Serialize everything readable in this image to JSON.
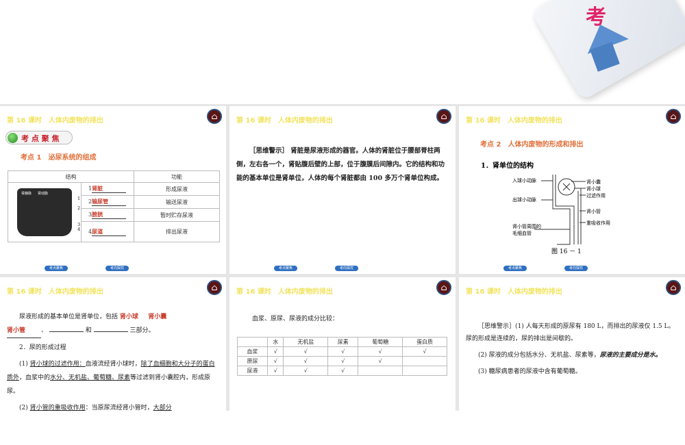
{
  "header_title": "第 16 课时　人体内废物的排出",
  "home_icon": "home-icon",
  "nav": {
    "prev": "考点聚焦",
    "next": "考向探究"
  },
  "deco_char": "考",
  "slide1": {
    "badge": "考 点 聚 焦",
    "point": "考点 1　泌尿系统的组成",
    "cols": [
      "结构",
      "功能"
    ],
    "rows": [
      {
        "n": "1",
        "ans": "肾脏",
        "func": "形成尿液"
      },
      {
        "n": "2",
        "ans": "输尿管",
        "func": "输送尿液"
      },
      {
        "n": "3",
        "ans": "膀胱",
        "func": "暂时贮存尿液"
      },
      {
        "n": "4",
        "ans": "尿道",
        "func": "排出尿液"
      }
    ],
    "img_labels": [
      "肾静脉",
      "肾动脉"
    ],
    "img_nums": [
      "1",
      "2",
      "3",
      "4"
    ]
  },
  "slide2": {
    "text": "［思维警示］ 肾脏是尿液形成的器官。人体的肾脏位于腰部脊柱两侧，左右各一个，肾贴腹后壁的上部，位于腹膜后间隙内。它的结构和功能的基本单位是肾单位，人体的每个肾脏都由 100 多万个肾单位构成。"
  },
  "slide3": {
    "point": "考点 2　人体内废物的形成和排出",
    "sub": "1．肾单位的结构",
    "labels_left": [
      "入球小动脉",
      "出球小动脉",
      "肾小管周围的",
      "毛细血管"
    ],
    "labels_right": [
      "肾小囊",
      "肾小球",
      "过滤作用",
      "肾小管",
      "重吸收作用"
    ],
    "caption": "图 16 － 1"
  },
  "slide4": {
    "l1": "尿液形成的基本单位是肾单位，包括",
    "a1": "肾小球",
    "a2": "肾小囊",
    "a3": "肾小管",
    "l2a": "、",
    "l2b": "和",
    "l2c": "三部分。",
    "sub": "2．尿的形成过程",
    "p1a": "(1) ",
    "p1u": "肾小球的过滤作用：",
    "p1b": "血液流经肾小球时，",
    "p1u2": "除了血细胞和大分子的蛋白质外",
    "p1c": "，血浆中的",
    "p1u3": "水分、无机盐、葡萄糖、尿素",
    "p1d": "等过滤到肾小囊腔内，形成原尿。",
    "p2a": "(2) ",
    "p2u": "肾小管的重吸收作用",
    "p2b": "：当原尿流经肾小管时，",
    "p2u2": "大部分"
  },
  "slide5": {
    "intro": "血浆、原尿、尿液的成分比较：",
    "cols": [
      "",
      "水",
      "无机盐",
      "尿素",
      "葡萄糖",
      "蛋白质"
    ],
    "rows": [
      [
        "血浆",
        "√",
        "√",
        "√",
        "√",
        "√"
      ],
      [
        "原尿",
        "√",
        "√",
        "√",
        "√",
        ""
      ],
      [
        "尿液",
        "√",
        "√",
        "√",
        "",
        ""
      ]
    ]
  },
  "slide6": {
    "p1": "［思维警示］(1) 人每天形成的原尿有 180 L，而排出的尿液仅 1.5 L。尿的形成是连续的，尿的排出是间歇的。",
    "p2a": "(2) 尿液的成分包括水分、无机盐、尿素等，",
    "p2b": "尿液的主要成分是水。",
    "p3": "(3) 糖尿病患者的尿液中含有葡萄糖。"
  }
}
